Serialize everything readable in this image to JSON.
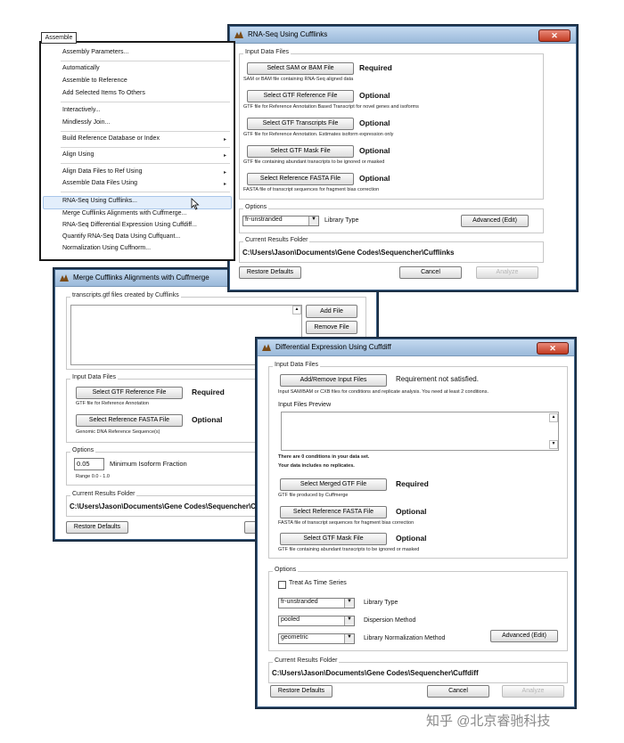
{
  "menu": {
    "tab_label": "Assemble",
    "items": [
      {
        "label": "Assembly Parameters...",
        "arrow": ""
      },
      {
        "label": "Automatically",
        "arrow": ""
      },
      {
        "label": "Assemble to Reference",
        "arrow": ""
      },
      {
        "label": "Add Selected Items To Others",
        "arrow": ""
      },
      {
        "label": "Interactively...",
        "arrow": ""
      },
      {
        "label": "Mindlessly Join...",
        "arrow": ""
      },
      {
        "label": "Build Reference Database or Index",
        "arrow": "▸"
      },
      {
        "label": "Align Using",
        "arrow": "▸"
      },
      {
        "label": "Align Data Files to Ref Using",
        "arrow": "▸"
      },
      {
        "label": "Assemble Data Files Using",
        "arrow": "▸"
      },
      {
        "label": "RNA-Seq Using Cufflinks...",
        "arrow": ""
      },
      {
        "label": "Merge Cufflinks Alignments with Cuffmerge...",
        "arrow": ""
      },
      {
        "label": "RNA-Seq Differential Expression Using Cuffdiff...",
        "arrow": ""
      },
      {
        "label": "Quantify RNA-Seq Data Using Cuffquant...",
        "arrow": ""
      },
      {
        "label": "Normalization Using Cuffnorm...",
        "arrow": ""
      }
    ]
  },
  "cufflinks": {
    "title": "RNA-Seq Using Cufflinks",
    "close": "✕",
    "input_group_label": "Input Data Files",
    "rows": [
      {
        "button": "Select SAM or BAM File",
        "status": "Required",
        "note": "SAM or BAM file containing RNA-Seq aligned data"
      },
      {
        "button": "Select GTF Reference File",
        "status": "Optional",
        "note": "GTF file for Reference Annotation Based Transcript for novel genes and isoforms"
      },
      {
        "button": "Select GTF Transcripts File",
        "status": "Optional",
        "note": "GTF file for Reference Annotation. Estimates isoform expression only"
      },
      {
        "button": "Select GTF Mask File",
        "status": "Optional",
        "note": "GTF file containing abundant transcripts to be ignored or masked"
      },
      {
        "button": "Select Reference FASTA File",
        "status": "Optional",
        "note": "FASTA file of transcript sequences for fragment bias correction"
      }
    ],
    "options_label": "Options",
    "library_value": "fr-unstranded",
    "library_label": "Library Type",
    "advanced": "Advanced (Edit)",
    "results_label": "Current Results Folder",
    "results_path": "C:\\Users\\Jason\\Documents\\Gene Codes\\Sequencher\\Cufflinks",
    "restore": "Restore Defaults",
    "cancel": "Cancel",
    "analyze": "Analyze"
  },
  "cuffmerge": {
    "title": "Merge Cufflinks Alignments with Cuffmerge",
    "transcripts_label": "transcripts.gtf files created by Cufflinks",
    "add_file": "Add File",
    "remove_file": "Remove File",
    "input_group_label": "Input Data Files",
    "rows": [
      {
        "button": "Select GTF Reference File",
        "status": "Required",
        "note": "GTF file for Reference Annotation"
      },
      {
        "button": "Select Reference FASTA File",
        "status": "Optional",
        "note": "Genomic DNA Reference Sequence(s)"
      }
    ],
    "options_label": "Options",
    "fraction_value": "0.05",
    "fraction_label": "Minimum Isoform Fraction",
    "range": "Range 0.0 - 1.0",
    "results_label": "Current Results Folder",
    "results_path": "C:\\Users\\Jason\\Documents\\Gene Codes\\Sequencher\\Cuffmerge",
    "restore": "Restore Defaults",
    "cancel_partial": "Ca"
  },
  "cuffdiff": {
    "title": "Differential Expression Using Cuffdiff",
    "close": "✕",
    "input_group_label": "Input Data Files",
    "add_remove": "Add/Remove Input Files",
    "requirement": "Requirement not satisfied.",
    "input_note": "Input SAM/BAM or CXB files for conditions and replicate analysis.  You need at least 2 conditions.",
    "preview_label": "Input Files Preview",
    "conditions_line1": "There are 0 conditions in your data set.",
    "conditions_line2": "Your data includes no replicates.",
    "rows": [
      {
        "button": "Select Merged GTF File",
        "status": "Required",
        "note": "GTF file produced by Cuffmerge"
      },
      {
        "button": "Select Reference FASTA File",
        "status": "Optional",
        "note": "FASTA file of transcript sequences for fragment bias correction"
      },
      {
        "button": "Select GTF Mask File",
        "status": "Optional",
        "note": "GTF file containing abundant transcripts to be ignored or masked"
      }
    ],
    "options_label": "Options",
    "time_series": "Treat As Time Series",
    "library_value": "fr-unstranded",
    "library_label": "Library Type",
    "dispersion_value": "pooled",
    "dispersion_label": "Dispersion Method",
    "norm_value": "geometric",
    "norm_label": "Library Normalization Method",
    "advanced": "Advanced (Edit)",
    "results_label": "Current Results Folder",
    "results_path": "C:\\Users\\Jason\\Documents\\Gene Codes\\Sequencher\\Cuffdiff",
    "restore": "Restore Defaults",
    "cancel": "Cancel",
    "analyze": "Analyze"
  },
  "watermark": "知乎 @北京睿驰科技"
}
